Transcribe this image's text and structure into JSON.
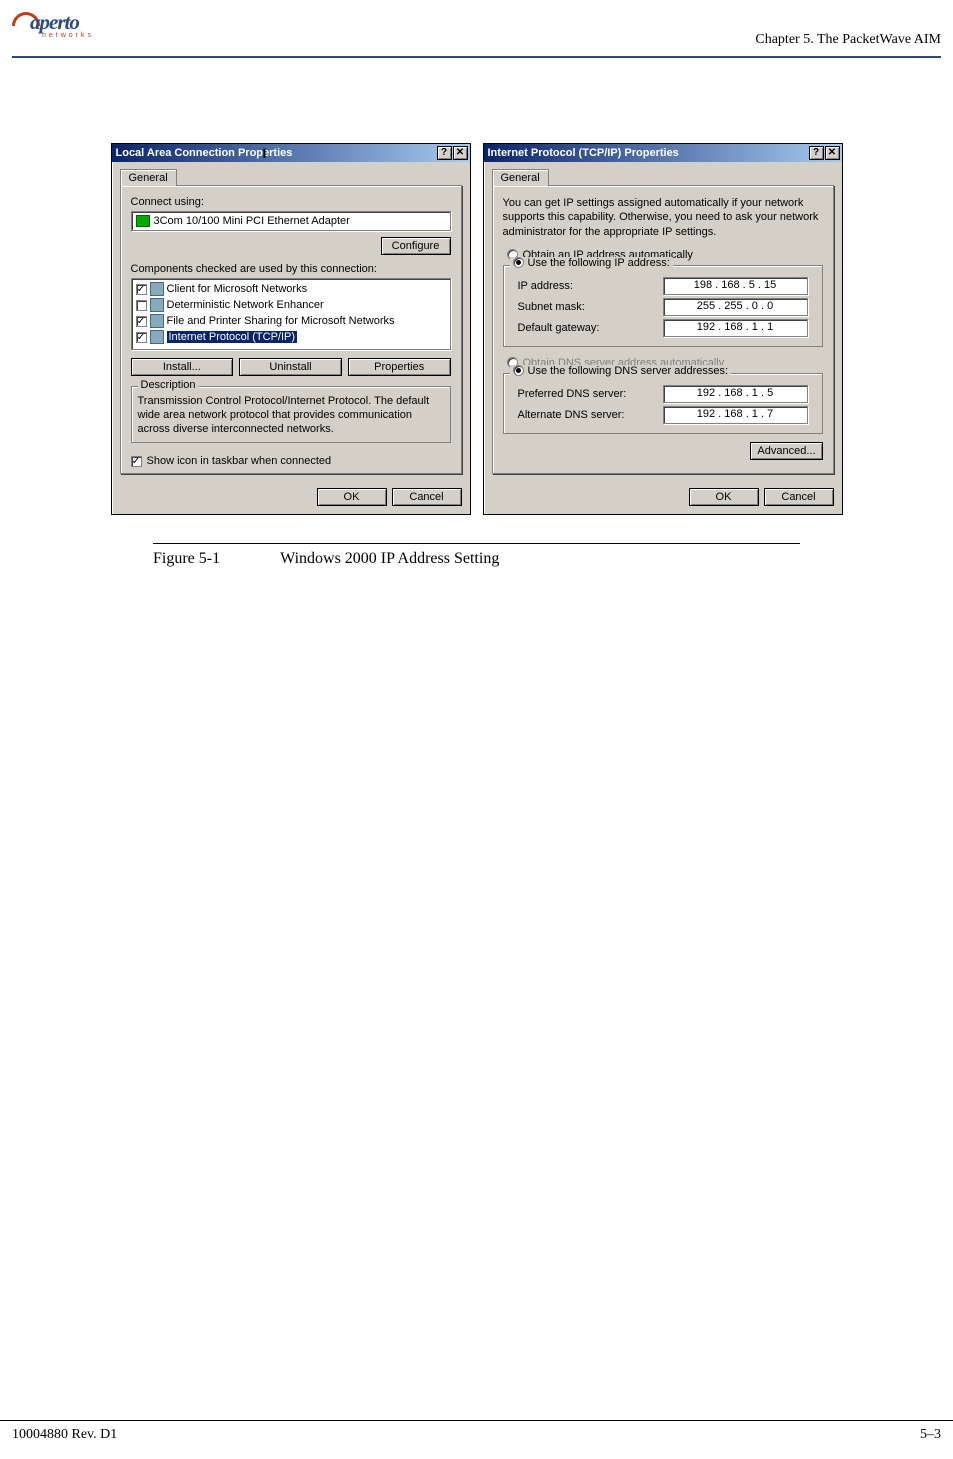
{
  "header": {
    "logo_text": "aperto",
    "logo_sub": "networks",
    "chapter": "Chapter 5.  The PacketWave AIM"
  },
  "dialog_a": {
    "title": "Local Area Connection Properties",
    "tab": "General",
    "connect_using_label": "Connect using:",
    "adapter": "3Com 10/100 Mini PCI Ethernet Adapter",
    "configure_btn": "Configure",
    "components_label": "Components checked are used by this connection:",
    "components": [
      {
        "checked": true,
        "label": "Client for Microsoft Networks",
        "selected": false
      },
      {
        "checked": false,
        "label": "Deterministic Network Enhancer",
        "selected": false
      },
      {
        "checked": true,
        "label": "File and Printer Sharing for Microsoft Networks",
        "selected": false
      },
      {
        "checked": true,
        "label": "Internet Protocol (TCP/IP)",
        "selected": true
      }
    ],
    "install_btn": "Install...",
    "uninstall_btn": "Uninstall",
    "properties_btn": "Properties",
    "description_legend": "Description",
    "description_text": "Transmission Control Protocol/Internet Protocol. The default wide area network protocol that provides communication across diverse interconnected networks.",
    "show_icon": "Show icon in taskbar when connected",
    "ok_btn": "OK",
    "cancel_btn": "Cancel"
  },
  "dialog_b": {
    "title": "Internet Protocol (TCP/IP) Properties",
    "tab": "General",
    "intro": "You can get IP settings assigned automatically if your network supports this capability. Otherwise, you need to ask your network administrator for the appropriate IP settings.",
    "radio_auto_ip": "Obtain an IP address automatically",
    "radio_use_ip": "Use the following IP address:",
    "ip_label": "IP address:",
    "ip_value": "198 . 168 .   5   .  15",
    "subnet_label": "Subnet mask:",
    "subnet_value": "255 . 255 .   0   .   0",
    "gateway_label": "Default gateway:",
    "gateway_value": "192 . 168 .   1   .   1",
    "radio_auto_dns": "Obtain DNS server address automatically",
    "radio_use_dns": "Use the following DNS server addresses:",
    "pref_dns_label": "Preferred DNS server:",
    "pref_dns_value": "192 . 168 .   1   .   5",
    "alt_dns_label": "Alternate DNS server:",
    "alt_dns_value": "192 . 168 .   1   .   7",
    "advanced_btn": "Advanced...",
    "ok_btn": "OK",
    "cancel_btn": "Cancel"
  },
  "figure": {
    "number": "Figure 5-1",
    "caption": "Windows 2000 IP Address Setting"
  },
  "footer": {
    "left": "10004880 Rev. D1",
    "right": "5–3"
  }
}
